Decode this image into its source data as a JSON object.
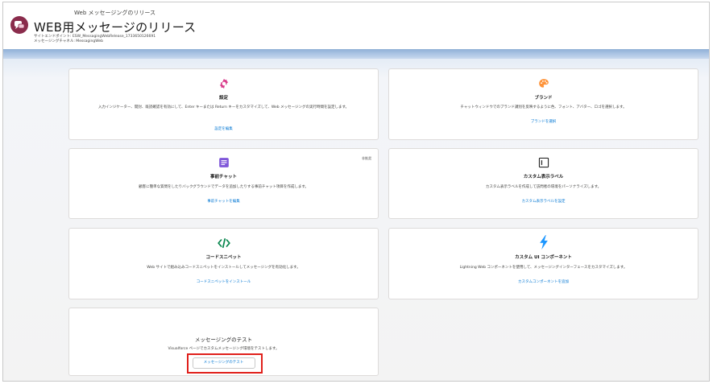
{
  "header": {
    "eyebrow": "Web メッセージングのリリース",
    "title": "WEB用メッセージのリリース",
    "meta_1": "サイトエンドポイント: ESW_MessagingWebRelease_1733650126691",
    "meta_2": "メッセージングチャネル: MessagingWeb"
  },
  "cards": {
    "settings": {
      "icon": "gear-icon",
      "title": "設定",
      "desc": "入力インジケーター、開封、既読確認を有効にして、Enter キーまたは Return キーをカスタマイズして、Web メッセージングの実行時間を設定します。",
      "link": "設定を編集"
    },
    "brand": {
      "icon": "palette-icon",
      "title": "ブランド",
      "desc": "チャットウィンドウでのブランド識別を反映するように色、フォント、アバター、ロゴを選択します。",
      "link": "ブランドを選択"
    },
    "prechat": {
      "icon": "form-icon",
      "title": "事前チャット",
      "badge": "非推奨",
      "desc": "顧客に簡単な質問をしたりバックグラウンドでデータを追加したりする事前チャット項目を作成します。",
      "link": "事前チャットを編集"
    },
    "labels": {
      "icon": "custom-label-icon",
      "title": "カスタム表示ラベル",
      "desc": "カスタム表示ラベルを作成して訪問者の環境をパーソナライズします。",
      "link": "カスタム表示ラベルを設定"
    },
    "snippet": {
      "icon": "code-icon",
      "title": "コードスニペット",
      "desc": "Web サイトで組み込みコードスニペットをインストールしてメッセージングを有効化します。",
      "link": "コードスニペットをインストール"
    },
    "ui": {
      "icon": "lightning-icon",
      "title": "カスタム UI コンポーネント",
      "desc": "Lightning Web コンポーネントを使用して、メッセージングインターフェースをカスタマイズします。",
      "link": "カスタムコンポーネントを追加"
    },
    "test": {
      "title": "メッセージングのテスト",
      "desc": "Visualforce ページでカスタムメッセージング環境をテストします。",
      "button": "メッセージングのテスト"
    }
  },
  "colors": {
    "accent_pink": "#d93b8a",
    "accent_orange": "#fe9339",
    "accent_purple": "#7f56d9",
    "accent_green": "#04844b",
    "accent_blue": "#1b96ff",
    "highlight_red": "#e0201b",
    "link_blue": "#0176d3"
  }
}
